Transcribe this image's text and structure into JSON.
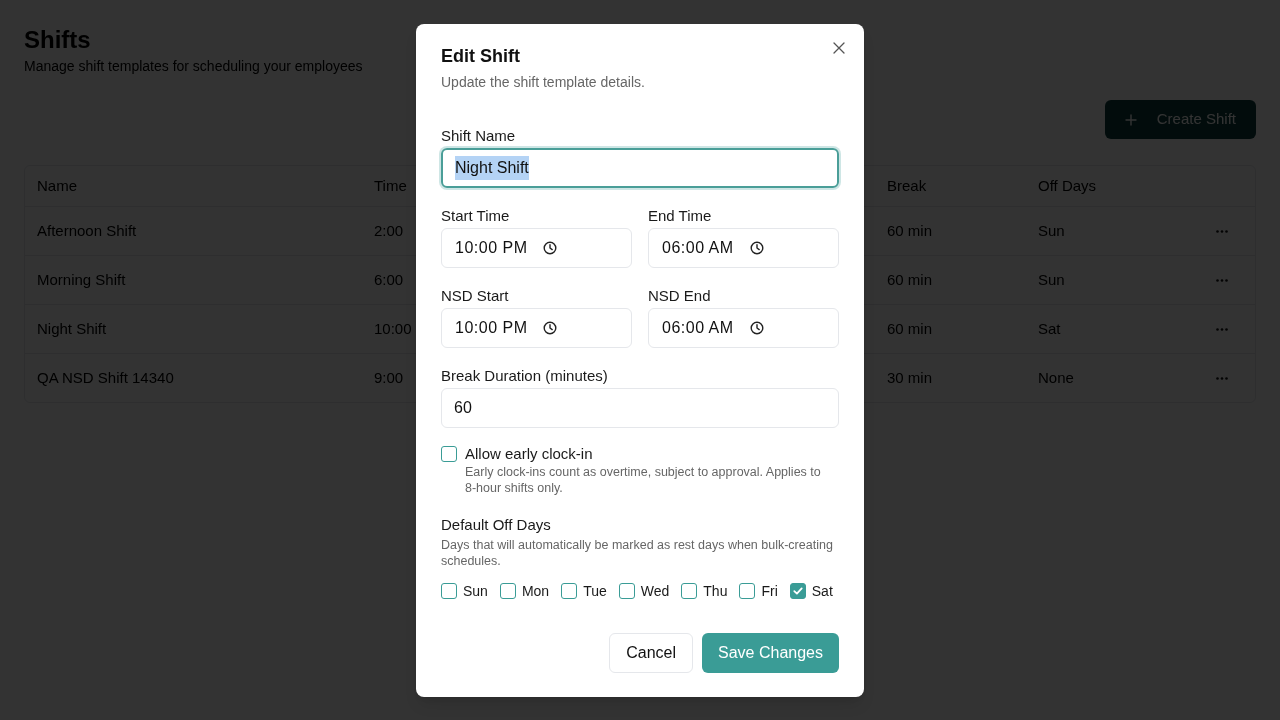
{
  "page": {
    "title": "Shifts",
    "subtitle": "Manage shift templates for scheduling your employees",
    "create_button": {
      "label": "Create Shift"
    }
  },
  "table": {
    "columns": [
      "Name",
      "Time",
      "Break",
      "Off Days"
    ],
    "rows": [
      {
        "name": "Afternoon Shift",
        "time": "2:00",
        "break": "60 min",
        "off_days": "Sun"
      },
      {
        "name": "Morning Shift",
        "time": "6:00",
        "break": "60 min",
        "off_days": "Sun"
      },
      {
        "name": "Night Shift",
        "time": "10:00",
        "break": "60 min",
        "off_days": "Sat"
      },
      {
        "name": "QA NSD Shift 14340",
        "time": "9:00",
        "break": "30 min",
        "off_days": "None"
      }
    ]
  },
  "dialog": {
    "title": "Edit Shift",
    "subtitle": "Update the shift template details.",
    "shift_name": {
      "label": "Shift Name",
      "value": "Night Shift",
      "focused": true,
      "text_selected": true
    },
    "time_fields": [
      {
        "label": "Start Time",
        "value": "10:00 PM"
      },
      {
        "label": "End Time",
        "value": "06:00 AM"
      },
      {
        "label": "NSD Start",
        "value": "10:00 PM"
      },
      {
        "label": "NSD End",
        "value": "06:00 AM"
      }
    ],
    "break_duration": {
      "label": "Break Duration (minutes)",
      "value": "60"
    },
    "early_clock_in": {
      "label": "Allow early clock-in",
      "description": "Early clock-ins count as overtime, subject to approval. Applies to 8-hour shifts only.",
      "checked": false
    },
    "off_days": {
      "label": "Default Off Days",
      "description": "Days that will automatically be marked as rest days when bulk-creating schedules.",
      "days": [
        {
          "label": "Sun",
          "checked": false
        },
        {
          "label": "Mon",
          "checked": false
        },
        {
          "label": "Tue",
          "checked": false
        },
        {
          "label": "Wed",
          "checked": false
        },
        {
          "label": "Thu",
          "checked": false
        },
        {
          "label": "Fri",
          "checked": false
        },
        {
          "label": "Sat",
          "checked": true
        }
      ]
    },
    "buttons": [
      {
        "kind": "secondary",
        "label": "Cancel"
      },
      {
        "kind": "primary",
        "label": "Save Changes"
      }
    ]
  }
}
